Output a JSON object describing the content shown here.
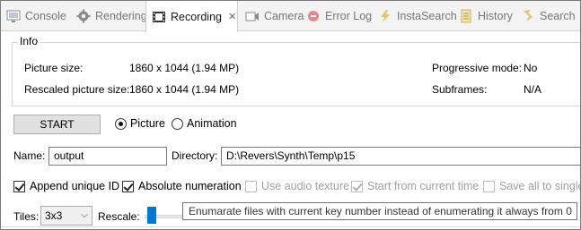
{
  "tabs": [
    {
      "label": "Console",
      "icon": "monitor-icon"
    },
    {
      "label": "Rendering",
      "icon": "gear-icon"
    },
    {
      "label": "Recording",
      "icon": "film-icon",
      "active": true
    },
    {
      "label": "Camera",
      "icon": "camera-icon"
    },
    {
      "label": "Error Log",
      "icon": "error-log-icon"
    },
    {
      "label": "InstaSearch",
      "icon": "instasearch-icon"
    },
    {
      "label": "History",
      "icon": "history-icon"
    },
    {
      "label": "Search",
      "icon": "search-icon"
    }
  ],
  "info": {
    "legend": "Info",
    "picture_size_label": "Picture size:",
    "picture_size_value": "1860 x 1044 (1.94 MP)",
    "rescaled_label": "Rescaled picture size:",
    "rescaled_value": "1860 x 1044 (1.94 MP)",
    "progressive_label": "Progressive mode:",
    "progressive_value": "No",
    "subframes_label": "Subframes:",
    "subframes_value": "N/A"
  },
  "controls": {
    "start_label": "START",
    "radio_picture": "Picture",
    "radio_animation": "Animation",
    "selected_mode": "Picture",
    "name_label": "Name:",
    "name_value": "output",
    "directory_label": "Directory:",
    "directory_value": "D:\\Revers\\Synth\\Temp\\p15",
    "append_unique_id": "Append unique ID",
    "absolute_numeration": "Absolute numeration",
    "use_audio_texture": "Use audio texture",
    "start_from_current_time": "Start from current time",
    "save_all_to_single": "Save all to single E",
    "tiles_label": "Tiles:",
    "tiles_value": "3x3",
    "rescale_label": "Rescale:"
  },
  "tooltip": "Enumarate files with current key number instead of enumerating it always from 0",
  "colors": {
    "accent": "#0078d7",
    "tab_bar_bg": "#f3f3f3",
    "disabled_text": "#a0a0a0"
  }
}
